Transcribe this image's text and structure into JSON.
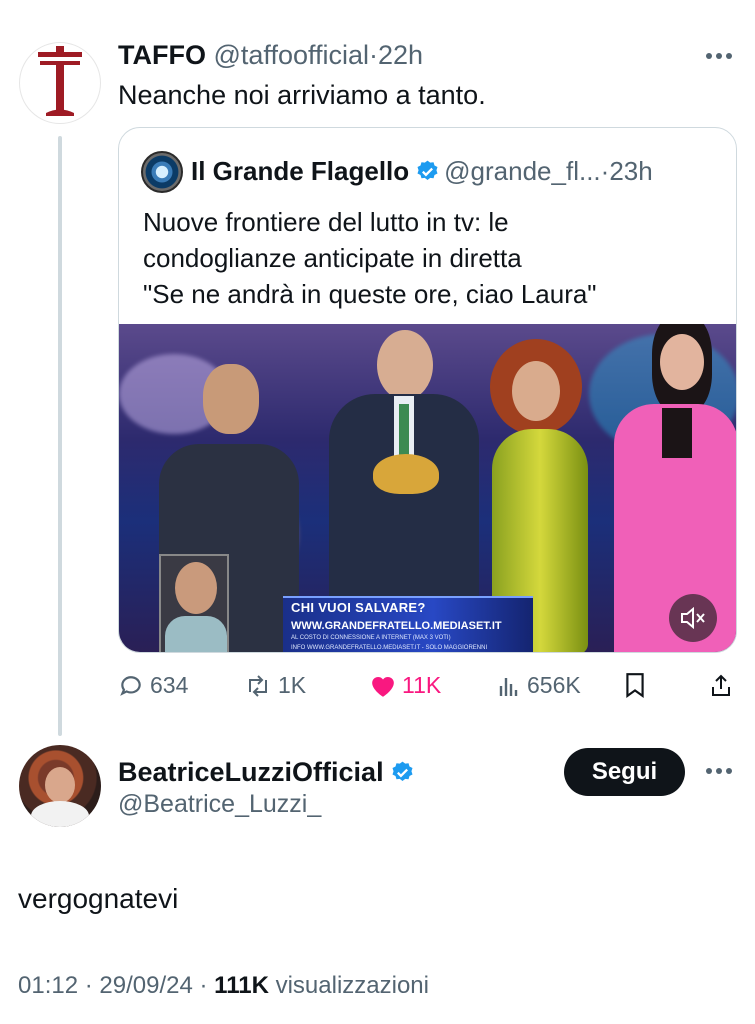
{
  "tweet": {
    "author_name": "TAFFO",
    "author_handle": "@taffoofficial",
    "separator": "·",
    "time": "22h",
    "text": "Neanche noi arriviamo a tanto.",
    "avatar_icon": "taffo-t-logo",
    "more_icon": "more-dots-icon"
  },
  "quoted_tweet": {
    "author_name": "Il Grande Flagello",
    "verified": true,
    "author_handle": "@grande_fl...",
    "separator": "·",
    "time": "23h",
    "text_lines": [
      "Nuove frontiere del lutto in tv: le",
      "condoglianze anticipate in diretta",
      "\"Se ne andrà in queste ore, ciao Laura\""
    ],
    "media": {
      "banner_title": "CHI VUOI SALVARE?",
      "banner_url": "WWW.GRANDEFRATELLO.MEDIASET.IT",
      "banner_small_1": "AL COSTO DI CONNESSIONE A INTERNET (MAX 3 VOTI)",
      "banner_small_2": "INFO WWW.GRANDEFRATELLO.MEDIASET.IT - SOLO MAGGIORENNI",
      "mute_icon": "speaker-muted-icon"
    }
  },
  "actions": {
    "replies": "634",
    "reposts": "1K",
    "likes": "11K",
    "views": "656K",
    "colors": {
      "liked": "#f91880",
      "muted": "#536471"
    }
  },
  "reply": {
    "author_name": "BeatriceLuzziOfficial",
    "verified": true,
    "author_handle": "@Beatrice_Luzzi_",
    "follow_label": "Segui",
    "text": "vergognatevi",
    "time": "01:12",
    "date": "29/09/24",
    "views_count": "111K",
    "views_label": "visualizzazioni",
    "separator": "·"
  }
}
